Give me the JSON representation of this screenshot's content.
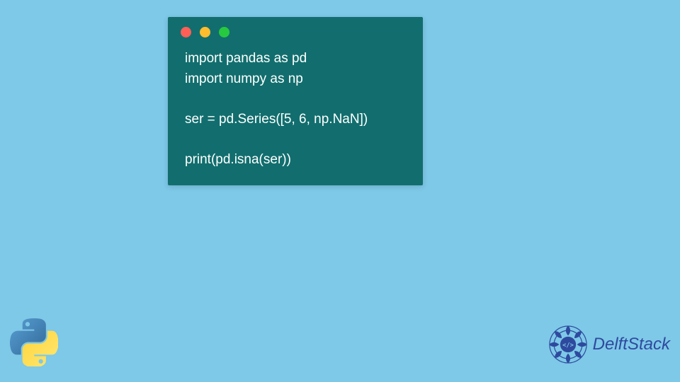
{
  "code": {
    "line1": "import pandas as pd",
    "line2": "import numpy as np",
    "line3": "",
    "line4": "ser = pd.Series([5, 6, np.NaN])",
    "line5": "",
    "line6": "print(pd.isna(ser))"
  },
  "branding": {
    "siteName": "DelftStack"
  },
  "colors": {
    "background": "#7ec8e8",
    "codeBackground": "#126e6e",
    "codeText": "#ffffff",
    "brandBlue": "#2e4a9e"
  }
}
